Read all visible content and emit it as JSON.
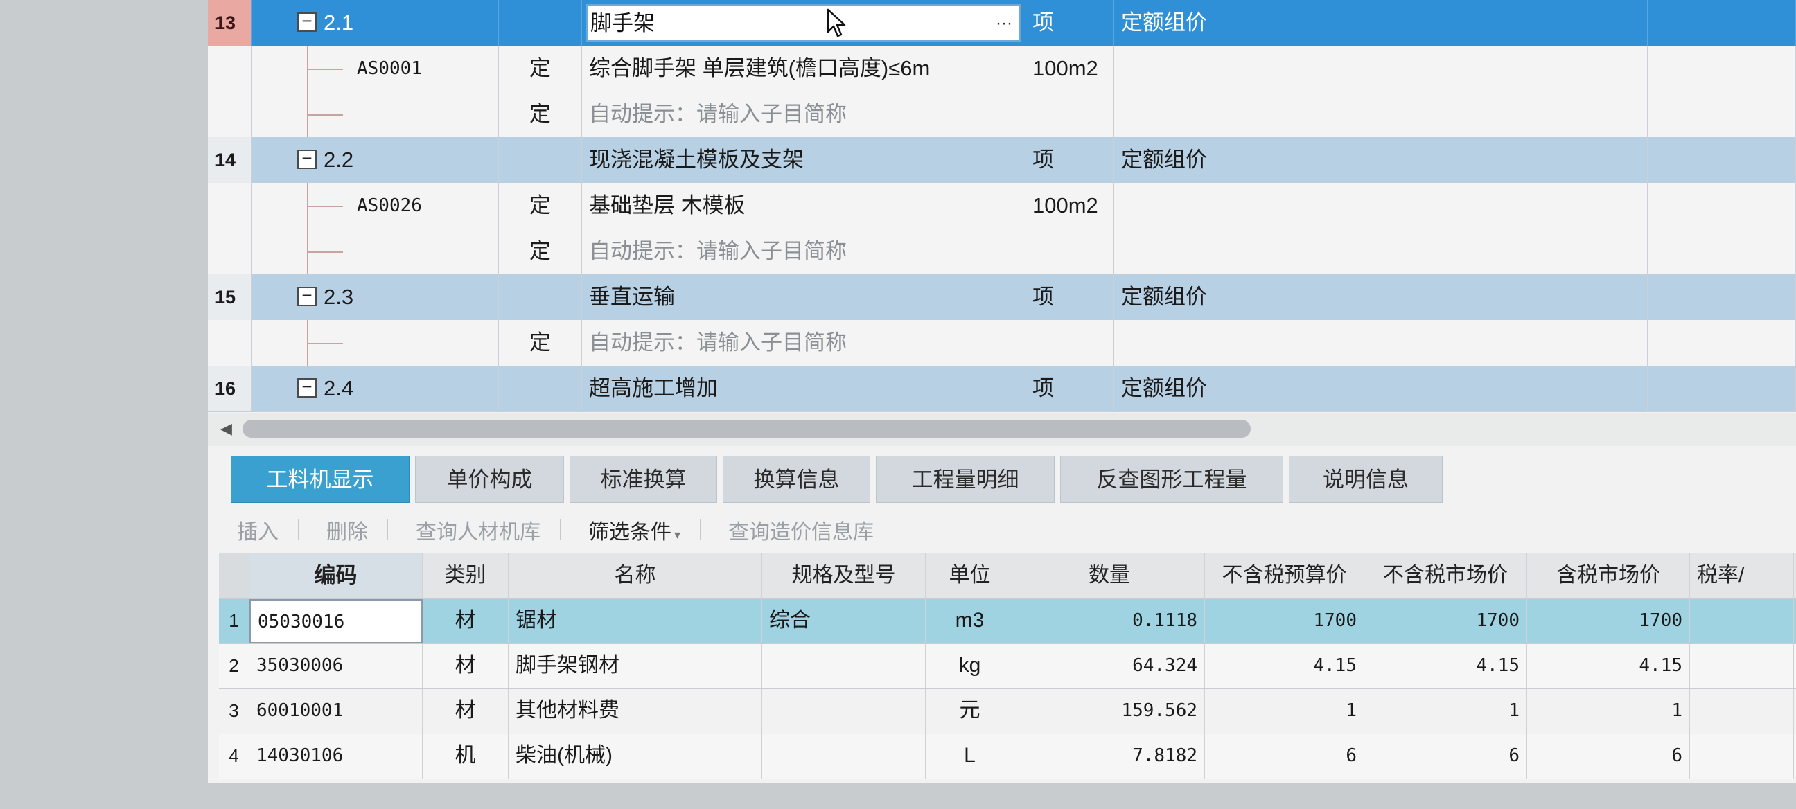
{
  "upper_rows": [
    {
      "no": "13",
      "code": "2.1",
      "type": "",
      "name": "脚手架",
      "unit": "项",
      "method": "定额组价",
      "kind": "group",
      "selected": true,
      "ellipsis": "···"
    },
    {
      "no": "",
      "code": "AS0001",
      "type": "定",
      "name": "综合脚手架 单层建筑(檐口高度)≤6m",
      "unit": "100m2",
      "method": "",
      "kind": "child"
    },
    {
      "no": "",
      "code": "",
      "type": "定",
      "name": "自动提示：请输入子目简称",
      "unit": "",
      "method": "",
      "kind": "hint"
    },
    {
      "no": "14",
      "code": "2.2",
      "type": "",
      "name": "现浇混凝土模板及支架",
      "unit": "项",
      "method": "定额组价",
      "kind": "group"
    },
    {
      "no": "",
      "code": "AS0026",
      "type": "定",
      "name": "基础垫层 木模板",
      "unit": "100m2",
      "method": "",
      "kind": "child"
    },
    {
      "no": "",
      "code": "",
      "type": "定",
      "name": "自动提示：请输入子目简称",
      "unit": "",
      "method": "",
      "kind": "hint"
    },
    {
      "no": "15",
      "code": "2.3",
      "type": "",
      "name": "垂直运输",
      "unit": "项",
      "method": "定额组价",
      "kind": "group"
    },
    {
      "no": "",
      "code": "",
      "type": "定",
      "name": "自动提示：请输入子目简称",
      "unit": "",
      "method": "",
      "kind": "hint"
    },
    {
      "no": "16",
      "code": "2.4",
      "type": "",
      "name": "超高施工增加",
      "unit": "项",
      "method": "定额组价",
      "kind": "group"
    }
  ],
  "tabs": [
    "工料机显示",
    "单价构成",
    "标准换算",
    "换算信息",
    "工程量明细",
    "反查图形工程量",
    "说明信息"
  ],
  "toolbar": {
    "insert": "插入",
    "delete": "删除",
    "query_lib": "查询人材机库",
    "filter": "筛选条件",
    "query_price": "查询造价信息库"
  },
  "lower_headers": {
    "code": "编码",
    "category": "类别",
    "name": "名称",
    "spec": "规格及型号",
    "unit": "单位",
    "qty": "数量",
    "p1": "不含税预算价",
    "p2": "不含税市场价",
    "p3": "含税市场价",
    "tax": "税率/"
  },
  "lower_rows": [
    {
      "idx": "1",
      "code": "05030016",
      "category": "材",
      "name": "锯材",
      "spec": "综合",
      "unit": "m3",
      "qty": "0.1118",
      "p1": "1700",
      "p2": "1700",
      "p3": "1700"
    },
    {
      "idx": "2",
      "code": "35030006",
      "category": "材",
      "name": "脚手架钢材",
      "spec": "",
      "unit": "kg",
      "qty": "64.324",
      "p1": "4.15",
      "p2": "4.15",
      "p3": "4.15"
    },
    {
      "idx": "3",
      "code": "60010001",
      "category": "材",
      "name": "其他材料费",
      "spec": "",
      "unit": "元",
      "qty": "159.562",
      "p1": "1",
      "p2": "1",
      "p3": "1"
    },
    {
      "idx": "4",
      "code": "14030106",
      "category": "机",
      "name": "柴油(机械)",
      "spec": "",
      "unit": "L",
      "qty": "7.8182",
      "p1": "6",
      "p2": "6",
      "p3": "6"
    }
  ],
  "colors": {
    "selected_row": "#2f90d8",
    "group_row": "#b8d0e3",
    "active_tab": "#3aa0cf",
    "lower_selected": "#9fd3e2"
  }
}
